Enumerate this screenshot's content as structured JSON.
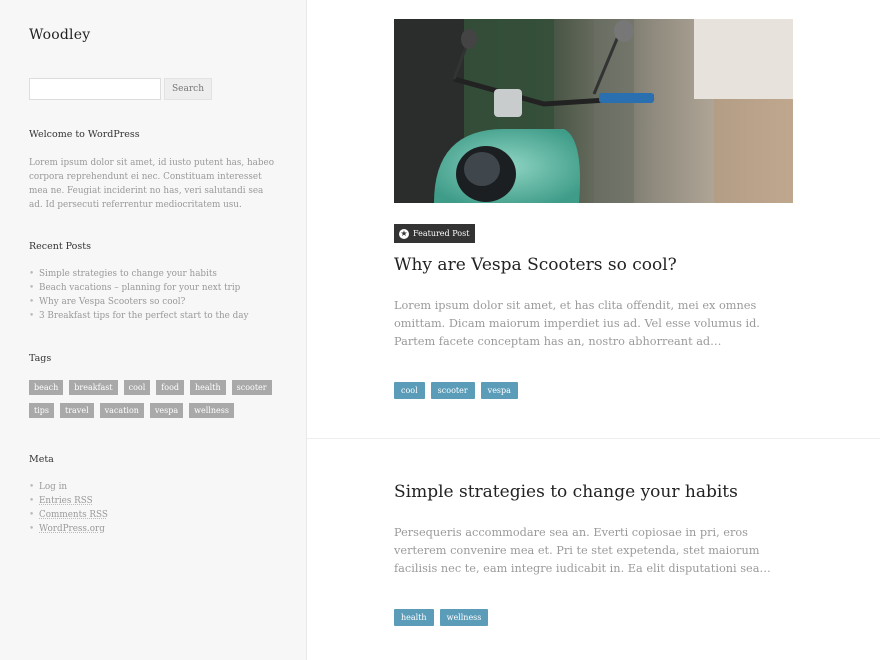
{
  "site": {
    "title": "Woodley"
  },
  "search": {
    "placeholder": "",
    "button_label": "Search"
  },
  "welcome": {
    "title": "Welcome to WordPress",
    "text": "Lorem ipsum dolor sit amet, id iusto putent has, habeo corpora reprehendunt ei nec. Constituam interesset mea ne. Feugiat inciderint no has, veri salutandi sea ad. Id persecuti referrentur mediocritatem usu."
  },
  "recent": {
    "title": "Recent Posts",
    "items": [
      "Simple strategies to change your habits",
      "Beach vacations – planning for your next trip",
      "Why are Vespa Scooters so cool?",
      "3 Breakfast tips for the perfect start to the day"
    ]
  },
  "tags": {
    "title": "Tags",
    "items": [
      "beach",
      "breakfast",
      "cool",
      "food",
      "health",
      "scooter",
      "tips",
      "travel",
      "vacation",
      "vespa",
      "wellness"
    ]
  },
  "meta": {
    "title": "Meta",
    "items": [
      "Log in",
      "Entries RSS",
      "Comments RSS",
      "WordPress.org"
    ]
  },
  "posts": [
    {
      "badge": "Featured Post",
      "title": "Why are Vespa Scooters so cool?",
      "excerpt": "Lorem ipsum dolor sit amet, et has clita offendit, mei ex omnes omittam. Dicam maiorum imperdiet ius ad. Vel esse volumus id. Partem facete conceptam has an, nostro abhorreant ad…",
      "tags": [
        "cool",
        "scooter",
        "vespa"
      ]
    },
    {
      "title": "Simple strategies to change your habits",
      "excerpt": "Persequeris accommodare sea an. Everti copiosae in pri, eros verterem convenire mea et. Pri te stet expetenda, stet maiorum facilisis nec te, eam integre iudicabit in. Ea elit disputationi sea…",
      "tags": [
        "health",
        "wellness"
      ]
    }
  ],
  "colors": {
    "tag_bg": "#a9a9a9",
    "post_tag_bg": "#5b9cb8",
    "badge_bg": "#333333"
  },
  "icons": {
    "badge": "star-icon"
  }
}
